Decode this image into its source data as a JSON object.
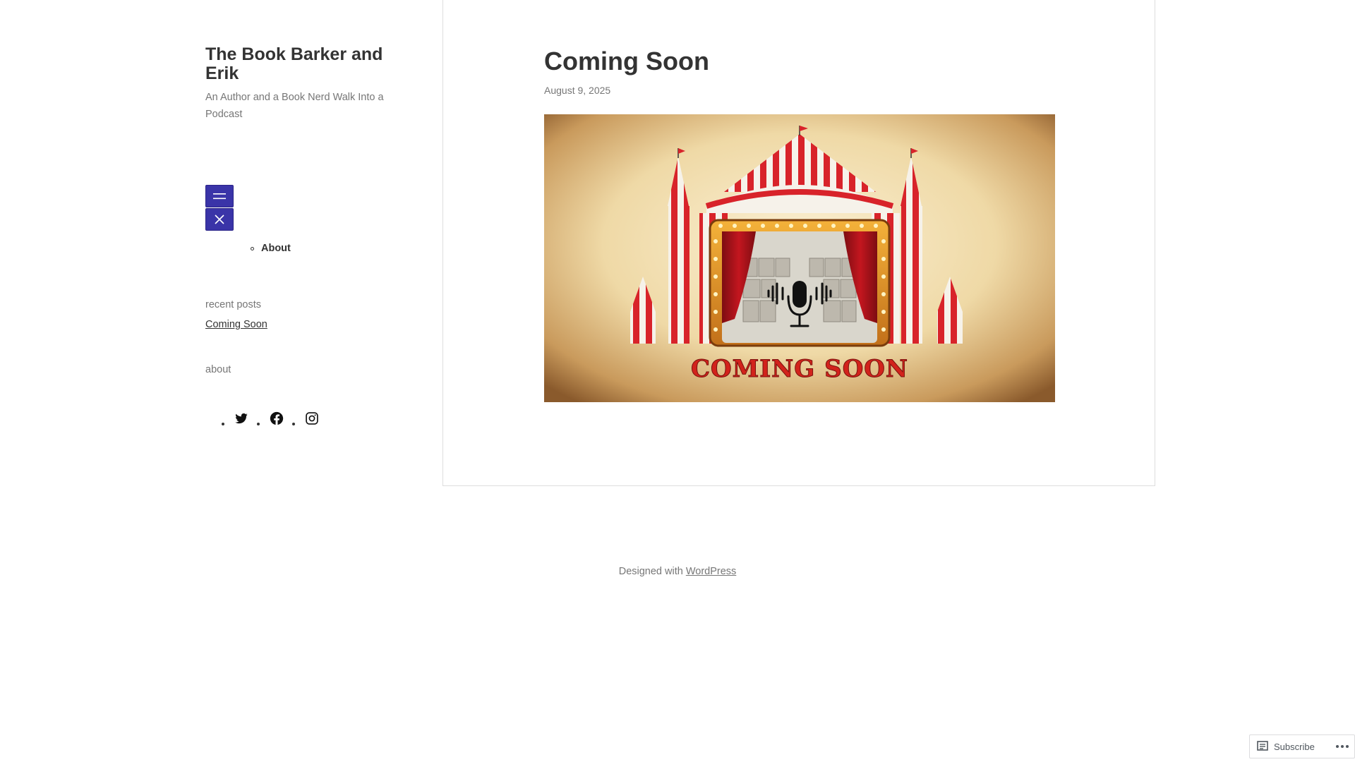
{
  "site": {
    "title": "The Book Barker and Erik",
    "tagline": "An Author and a Book Nerd Walk Into a Podcast"
  },
  "menu": {
    "open_icon": "hamburger-icon",
    "close_icon": "close-icon",
    "items": [
      {
        "label": "About"
      }
    ]
  },
  "widgets": {
    "recent_posts_title": "recent posts",
    "recent_posts": [
      {
        "label": "Coming Soon"
      }
    ],
    "about_title": "about",
    "social": [
      "twitter-icon",
      "facebook-icon",
      "instagram-icon"
    ]
  },
  "post": {
    "title": "Coming Soon",
    "date": "August 9, 2025",
    "image_text": "COMING SOON"
  },
  "footer": {
    "prefix": "Designed with",
    "link": "WordPress"
  },
  "subscribe": {
    "label": "Subscribe",
    "icon": "reader-icon",
    "more_icon": "ellipsis-icon"
  },
  "colors": {
    "menu_button": "#3a34a8",
    "text": "#333333",
    "muted": "#767676"
  }
}
